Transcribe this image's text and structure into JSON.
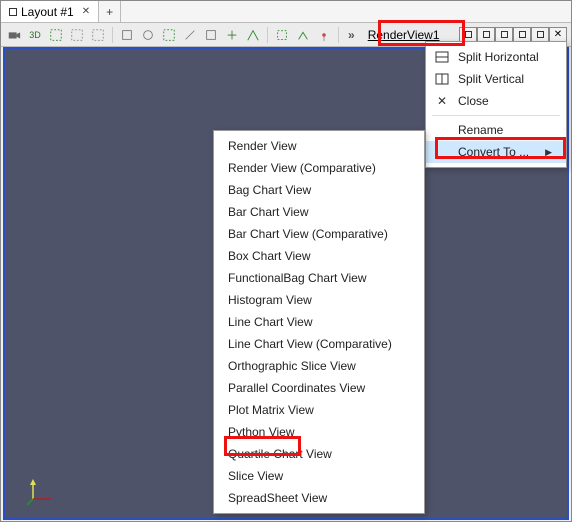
{
  "tab": {
    "label": "Layout #1"
  },
  "toolbar": {
    "mode3d": "3D",
    "overflow": "»",
    "view_name": "RenderView1"
  },
  "context_menu": {
    "split_h": "Split Horizontal",
    "split_v": "Split Vertical",
    "close": "Close",
    "rename": "Rename",
    "convert": "Convert To ..."
  },
  "convert_menu": {
    "items": [
      "Render View",
      "Render View (Comparative)",
      "Bag Chart View",
      "Bar Chart View",
      "Bar Chart View (Comparative)",
      "Box Chart View",
      "FunctionalBag Chart View",
      "Histogram View",
      "Line Chart View",
      "Line Chart View (Comparative)",
      "Orthographic Slice View",
      "Parallel Coordinates View",
      "Plot Matrix View",
      "Python View",
      "Quartile Chart View",
      "Slice View",
      "SpreadSheet View"
    ]
  }
}
